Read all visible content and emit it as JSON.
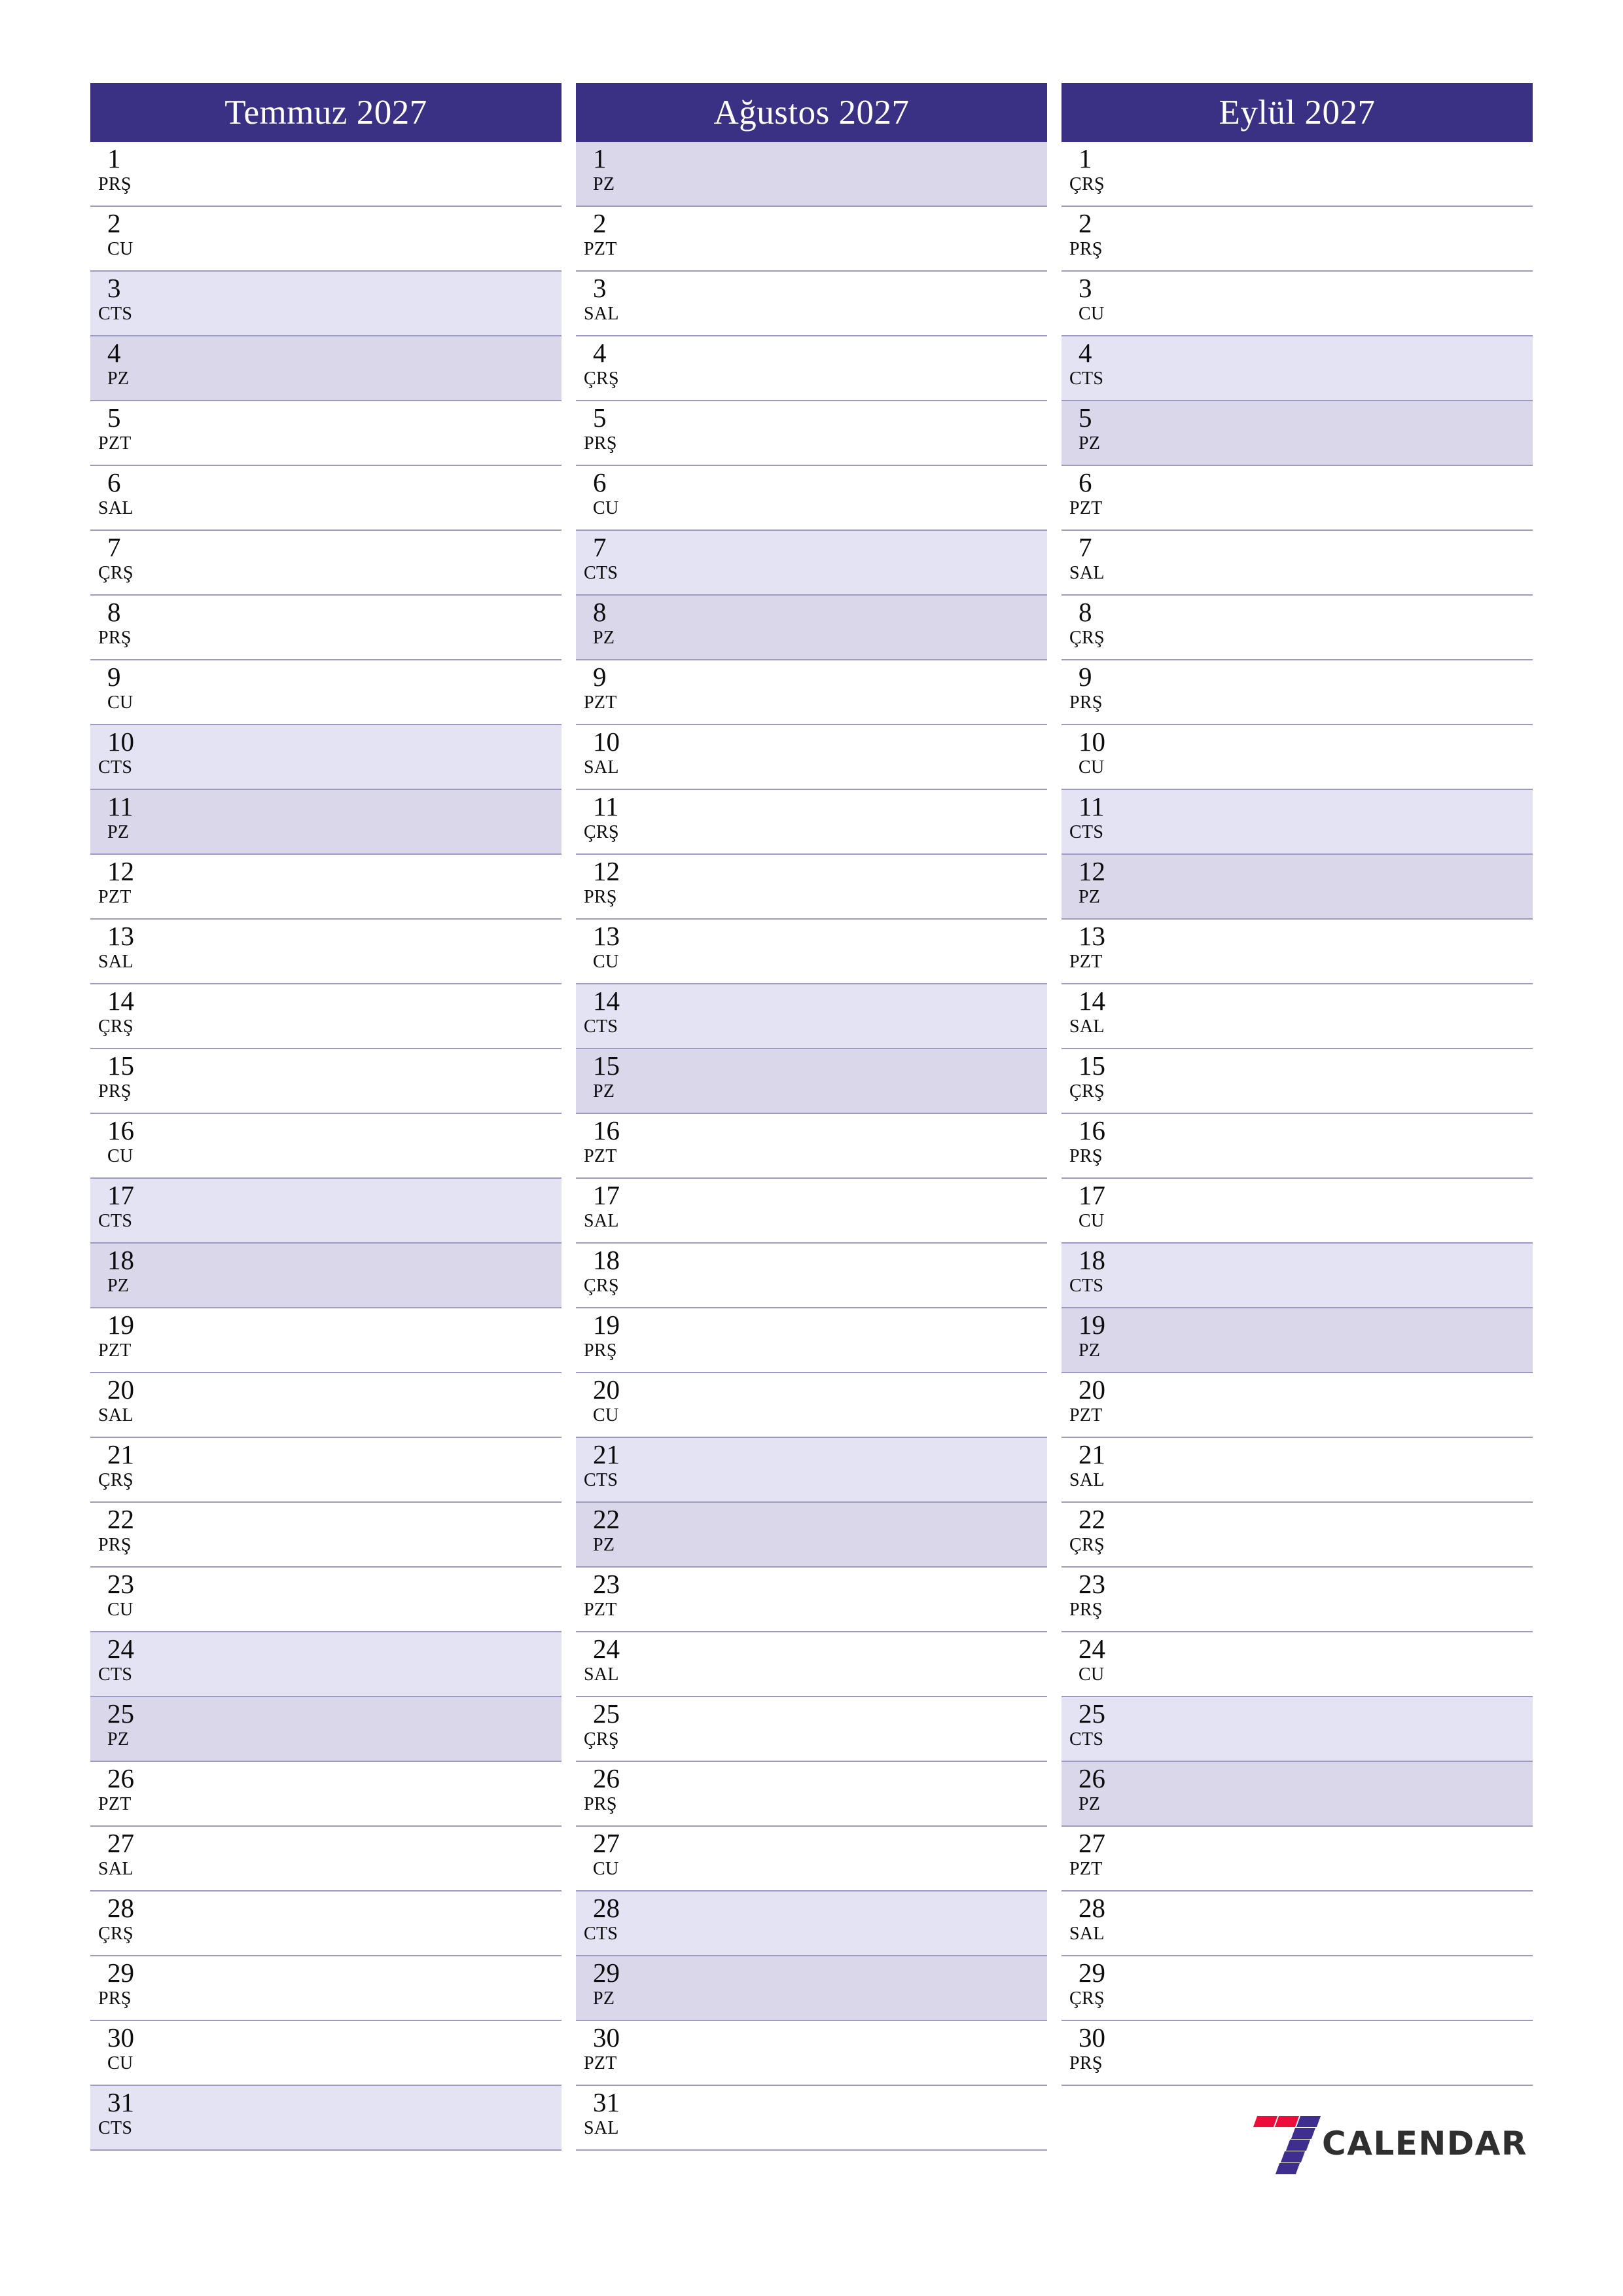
{
  "document": {
    "type": "monthly-planner",
    "language": "tr",
    "year": "2027",
    "orientation": "portrait"
  },
  "brand": {
    "word": "CALENDAR",
    "mark_icon": "seven-logo-icon",
    "colors": {
      "red": "#ed0c3a",
      "indigo": "#3f2e8e",
      "word": "#2f2f2f"
    }
  },
  "theme": {
    "header_bg": "#3a3185",
    "header_text": "#ffffff",
    "saturday_bg": "#e3e3f4",
    "sunday_bg": "#dbd7ea",
    "row_line": "#9d9bc4",
    "text": "#0c0c0c"
  },
  "weekday_abbreviations": {
    "monday": "PZT",
    "tuesday": "SAL",
    "wednesday": "ÇRŞ",
    "thursday": "PRŞ",
    "friday": "CU",
    "saturday": "CTS",
    "sunday": "PZ"
  },
  "months": [
    {
      "title": "Temmuz 2027",
      "name": "Temmuz",
      "days": [
        {
          "n": "1",
          "d": "PRŞ",
          "w": "thu"
        },
        {
          "n": "2",
          "d": "CU",
          "w": "fri"
        },
        {
          "n": "3",
          "d": "CTS",
          "w": "sat"
        },
        {
          "n": "4",
          "d": "PZ",
          "w": "sun"
        },
        {
          "n": "5",
          "d": "PZT",
          "w": "mon"
        },
        {
          "n": "6",
          "d": "SAL",
          "w": "tue"
        },
        {
          "n": "7",
          "d": "ÇRŞ",
          "w": "wed"
        },
        {
          "n": "8",
          "d": "PRŞ",
          "w": "thu"
        },
        {
          "n": "9",
          "d": "CU",
          "w": "fri"
        },
        {
          "n": "10",
          "d": "CTS",
          "w": "sat"
        },
        {
          "n": "11",
          "d": "PZ",
          "w": "sun"
        },
        {
          "n": "12",
          "d": "PZT",
          "w": "mon"
        },
        {
          "n": "13",
          "d": "SAL",
          "w": "tue"
        },
        {
          "n": "14",
          "d": "ÇRŞ",
          "w": "wed"
        },
        {
          "n": "15",
          "d": "PRŞ",
          "w": "thu"
        },
        {
          "n": "16",
          "d": "CU",
          "w": "fri"
        },
        {
          "n": "17",
          "d": "CTS",
          "w": "sat"
        },
        {
          "n": "18",
          "d": "PZ",
          "w": "sun"
        },
        {
          "n": "19",
          "d": "PZT",
          "w": "mon"
        },
        {
          "n": "20",
          "d": "SAL",
          "w": "tue"
        },
        {
          "n": "21",
          "d": "ÇRŞ",
          "w": "wed"
        },
        {
          "n": "22",
          "d": "PRŞ",
          "w": "thu"
        },
        {
          "n": "23",
          "d": "CU",
          "w": "fri"
        },
        {
          "n": "24",
          "d": "CTS",
          "w": "sat"
        },
        {
          "n": "25",
          "d": "PZ",
          "w": "sun"
        },
        {
          "n": "26",
          "d": "PZT",
          "w": "mon"
        },
        {
          "n": "27",
          "d": "SAL",
          "w": "tue"
        },
        {
          "n": "28",
          "d": "ÇRŞ",
          "w": "wed"
        },
        {
          "n": "29",
          "d": "PRŞ",
          "w": "thu"
        },
        {
          "n": "30",
          "d": "CU",
          "w": "fri"
        },
        {
          "n": "31",
          "d": "CTS",
          "w": "sat"
        }
      ]
    },
    {
      "title": "Ağustos 2027",
      "name": "Ağustos",
      "days": [
        {
          "n": "1",
          "d": "PZ",
          "w": "sun"
        },
        {
          "n": "2",
          "d": "PZT",
          "w": "mon"
        },
        {
          "n": "3",
          "d": "SAL",
          "w": "tue"
        },
        {
          "n": "4",
          "d": "ÇRŞ",
          "w": "wed"
        },
        {
          "n": "5",
          "d": "PRŞ",
          "w": "thu"
        },
        {
          "n": "6",
          "d": "CU",
          "w": "fri"
        },
        {
          "n": "7",
          "d": "CTS",
          "w": "sat"
        },
        {
          "n": "8",
          "d": "PZ",
          "w": "sun"
        },
        {
          "n": "9",
          "d": "PZT",
          "w": "mon"
        },
        {
          "n": "10",
          "d": "SAL",
          "w": "tue"
        },
        {
          "n": "11",
          "d": "ÇRŞ",
          "w": "wed"
        },
        {
          "n": "12",
          "d": "PRŞ",
          "w": "thu"
        },
        {
          "n": "13",
          "d": "CU",
          "w": "fri"
        },
        {
          "n": "14",
          "d": "CTS",
          "w": "sat"
        },
        {
          "n": "15",
          "d": "PZ",
          "w": "sun"
        },
        {
          "n": "16",
          "d": "PZT",
          "w": "mon"
        },
        {
          "n": "17",
          "d": "SAL",
          "w": "tue"
        },
        {
          "n": "18",
          "d": "ÇRŞ",
          "w": "wed"
        },
        {
          "n": "19",
          "d": "PRŞ",
          "w": "thu"
        },
        {
          "n": "20",
          "d": "CU",
          "w": "fri"
        },
        {
          "n": "21",
          "d": "CTS",
          "w": "sat"
        },
        {
          "n": "22",
          "d": "PZ",
          "w": "sun"
        },
        {
          "n": "23",
          "d": "PZT",
          "w": "mon"
        },
        {
          "n": "24",
          "d": "SAL",
          "w": "tue"
        },
        {
          "n": "25",
          "d": "ÇRŞ",
          "w": "wed"
        },
        {
          "n": "26",
          "d": "PRŞ",
          "w": "thu"
        },
        {
          "n": "27",
          "d": "CU",
          "w": "fri"
        },
        {
          "n": "28",
          "d": "CTS",
          "w": "sat"
        },
        {
          "n": "29",
          "d": "PZ",
          "w": "sun"
        },
        {
          "n": "30",
          "d": "PZT",
          "w": "mon"
        },
        {
          "n": "31",
          "d": "SAL",
          "w": "tue"
        }
      ]
    },
    {
      "title": "Eylül 2027",
      "name": "Eylül",
      "days": [
        {
          "n": "1",
          "d": "ÇRŞ",
          "w": "wed"
        },
        {
          "n": "2",
          "d": "PRŞ",
          "w": "thu"
        },
        {
          "n": "3",
          "d": "CU",
          "w": "fri"
        },
        {
          "n": "4",
          "d": "CTS",
          "w": "sat"
        },
        {
          "n": "5",
          "d": "PZ",
          "w": "sun"
        },
        {
          "n": "6",
          "d": "PZT",
          "w": "mon"
        },
        {
          "n": "7",
          "d": "SAL",
          "w": "tue"
        },
        {
          "n": "8",
          "d": "ÇRŞ",
          "w": "wed"
        },
        {
          "n": "9",
          "d": "PRŞ",
          "w": "thu"
        },
        {
          "n": "10",
          "d": "CU",
          "w": "fri"
        },
        {
          "n": "11",
          "d": "CTS",
          "w": "sat"
        },
        {
          "n": "12",
          "d": "PZ",
          "w": "sun"
        },
        {
          "n": "13",
          "d": "PZT",
          "w": "mon"
        },
        {
          "n": "14",
          "d": "SAL",
          "w": "tue"
        },
        {
          "n": "15",
          "d": "ÇRŞ",
          "w": "wed"
        },
        {
          "n": "16",
          "d": "PRŞ",
          "w": "thu"
        },
        {
          "n": "17",
          "d": "CU",
          "w": "fri"
        },
        {
          "n": "18",
          "d": "CTS",
          "w": "sat"
        },
        {
          "n": "19",
          "d": "PZ",
          "w": "sun"
        },
        {
          "n": "20",
          "d": "PZT",
          "w": "mon"
        },
        {
          "n": "21",
          "d": "SAL",
          "w": "tue"
        },
        {
          "n": "22",
          "d": "ÇRŞ",
          "w": "wed"
        },
        {
          "n": "23",
          "d": "PRŞ",
          "w": "thu"
        },
        {
          "n": "24",
          "d": "CU",
          "w": "fri"
        },
        {
          "n": "25",
          "d": "CTS",
          "w": "sat"
        },
        {
          "n": "26",
          "d": "PZ",
          "w": "sun"
        },
        {
          "n": "27",
          "d": "PZT",
          "w": "mon"
        },
        {
          "n": "28",
          "d": "SAL",
          "w": "tue"
        },
        {
          "n": "29",
          "d": "ÇRŞ",
          "w": "wed"
        },
        {
          "n": "30",
          "d": "PRŞ",
          "w": "thu"
        }
      ]
    }
  ]
}
